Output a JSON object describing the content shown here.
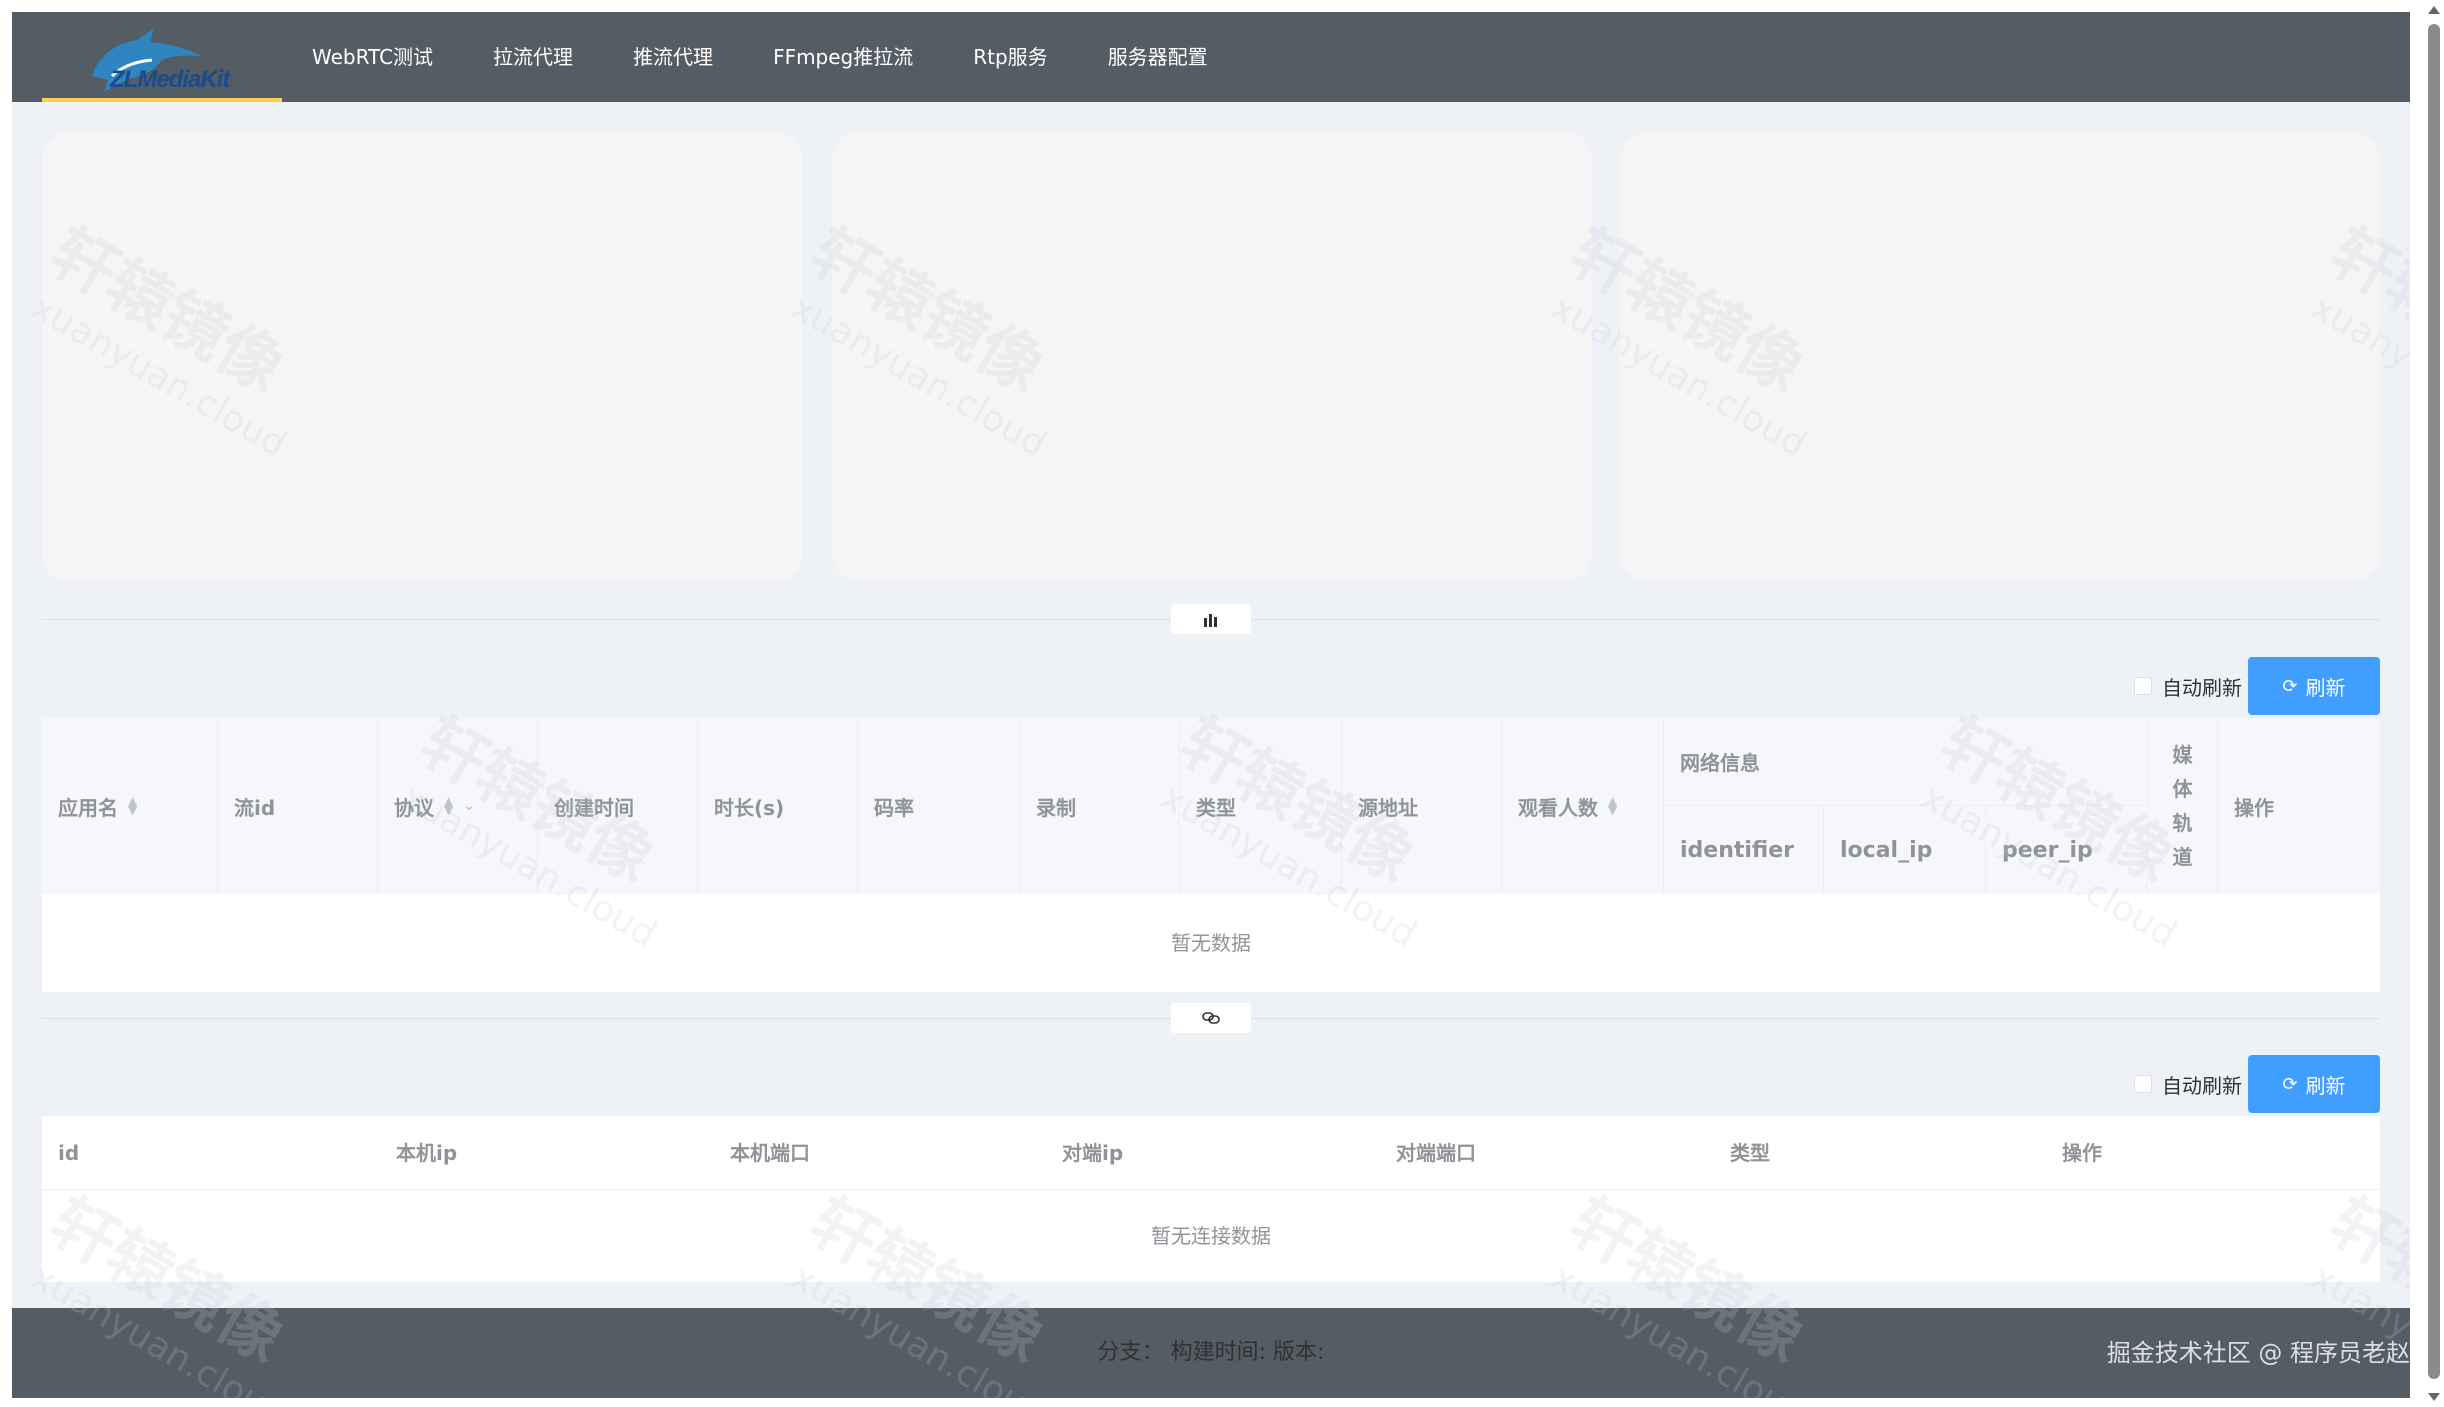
{
  "app": {
    "logo_text": "ZLMediaKit"
  },
  "nav": {
    "items": [
      {
        "label": "WebRTC测试"
      },
      {
        "label": "拉流代理"
      },
      {
        "label": "推流代理"
      },
      {
        "label": "FFmpeg推拉流"
      },
      {
        "label": "Rtp服务"
      },
      {
        "label": "服务器配置"
      }
    ]
  },
  "stream_section": {
    "auto_refresh_label": "自动刷新",
    "refresh_label": "刷新",
    "columns": {
      "app": "应用名",
      "stream_id": "流id",
      "protocol": "协议",
      "created": "创建时间",
      "duration": "时长(s)",
      "bitrate": "码率",
      "record": "录制",
      "type": "类型",
      "source": "源地址",
      "viewers": "观看人数",
      "network": "网络信息",
      "identifier": "identifier",
      "local_ip": "local_ip",
      "peer_ip": "peer_ip",
      "media_track": [
        "媒",
        "体",
        "轨",
        "道"
      ],
      "actions": "操作"
    },
    "empty_text": "暂无数据"
  },
  "connection_section": {
    "auto_refresh_label": "自动刷新",
    "refresh_label": "刷新",
    "columns": [
      "id",
      "本机ip",
      "本机端口",
      "对端ip",
      "对端端口",
      "类型",
      "操作"
    ],
    "empty_text": "暂无连接数据"
  },
  "footer": {
    "info": "分支：  构建时间: 版本:",
    "attribution": "掘金技术社区 @ 程序员老赵"
  },
  "watermark": {
    "cn": "轩辕镜像",
    "en": "xuanyuan.cloud"
  },
  "colors": {
    "header_bg": "#545c64",
    "accent": "#409eff",
    "active_nav": "#ffd04b",
    "page_bg": "#eef1f6"
  },
  "icons": {
    "chart_toggle": "bar-chart-icon",
    "connection_toggle": "link-icon",
    "refresh": "refresh-icon"
  }
}
